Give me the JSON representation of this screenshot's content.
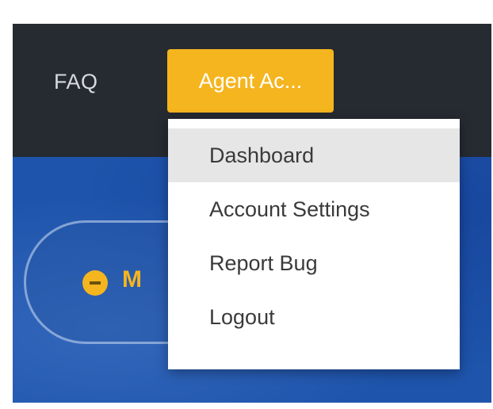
{
  "nav": {
    "faq_label": "FAQ",
    "account_label": "Agent Ac..."
  },
  "hero": {
    "label": "M"
  },
  "dropdown": {
    "items": [
      {
        "label": "Dashboard",
        "active": true
      },
      {
        "label": "Account Settings"
      },
      {
        "label": "Report Bug"
      },
      {
        "label": "Logout"
      }
    ]
  },
  "colors": {
    "topbar": "#262a31",
    "accent": "#f5b51f",
    "hero": "#1e54ab",
    "menu_bg": "#ffffff",
    "menu_hover": "#e6e6e6"
  }
}
